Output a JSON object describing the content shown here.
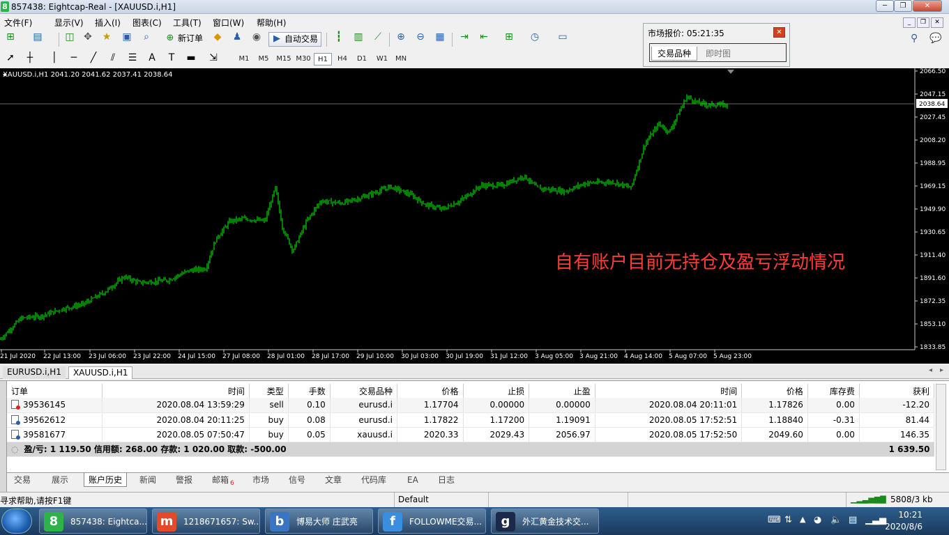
{
  "window": {
    "title": "857438: Eightcap-Real - [XAUUSD.i,H1]",
    "app_icon": "8"
  },
  "menu": [
    "文件(F)",
    "显示(V)",
    "插入(I)",
    "图表(C)",
    "工具(T)",
    "窗口(W)",
    "帮助(H)"
  ],
  "toolbar": {
    "new_order": "新订单",
    "auto_trading": "自动交易"
  },
  "timeframes": [
    "M1",
    "M5",
    "M15",
    "M30",
    "H1",
    "H4",
    "D1",
    "W1",
    "MN"
  ],
  "active_timeframe": "H1",
  "market_watch": {
    "title": "市场报价: 05:21:35",
    "tabs": [
      "交易品种",
      "即时图"
    ]
  },
  "chart": {
    "symbol_line": "XAUUSD.i,H1  2041.20 2041.62 2037.41 2038.64",
    "price_labels": [
      "2066.50",
      "2047.15",
      "2038.64",
      "2027.45",
      "2008.20",
      "1988.95",
      "1969.15",
      "1949.90",
      "1930.65",
      "1911.40",
      "1891.60",
      "1872.35",
      "1853.10",
      "1833.85"
    ],
    "current_price": "2038.64",
    "time_labels": [
      "21 Jul 2020",
      "22 Jul 13:00",
      "23 Jul 06:00",
      "23 Jul 22:00",
      "24 Jul 15:00",
      "27 Jul 08:00",
      "28 Jul 01:00",
      "28 Jul 17:00",
      "29 Jul 10:00",
      "30 Jul 03:00",
      "30 Jul 19:00",
      "31 Jul 12:00",
      "3 Aug 05:00",
      "3 Aug 21:00",
      "4 Aug 14:00",
      "5 Aug 07:00",
      "5 Aug 23:00"
    ],
    "annotation": "自有账户目前无持仓及盈亏浮动情况",
    "candle_color": "#00ff00"
  },
  "chart_tabs": [
    "EURUSD.i,H1",
    "XAUUSD.i,H1"
  ],
  "terminal": {
    "columns": [
      "订单",
      "时间",
      "类型",
      "手数",
      "交易品种",
      "价格",
      "止损",
      "止盈",
      "时间",
      "价格",
      "库存费",
      "获利"
    ],
    "rows": [
      [
        "39536145",
        "2020.08.04 13:59:29",
        "sell",
        "0.10",
        "eurusd.i",
        "1.17704",
        "0.00000",
        "0.00000",
        "2020.08.04 20:11:01",
        "1.17826",
        "0.00",
        "-12.20"
      ],
      [
        "39562612",
        "2020.08.04 20:11:25",
        "buy",
        "0.08",
        "eurusd.i",
        "1.17822",
        "1.17200",
        "1.19091",
        "2020.08.05 17:52:51",
        "1.18840",
        "-0.31",
        "81.44"
      ],
      [
        "39581677",
        "2020.08.05 07:50:47",
        "buy",
        "0.05",
        "xauusd.i",
        "2020.33",
        "2029.43",
        "2056.97",
        "2020.08.05 17:52:50",
        "2049.60",
        "0.00",
        "146.35"
      ]
    ],
    "summary": "盈/亏: 1 119.50  信用额: 268.00  存款: 1 020.00  取款: -500.00",
    "summary_total": "1 639.50",
    "tabs": [
      "交易",
      "展示",
      "账户历史",
      "新闻",
      "警报",
      "邮箱",
      "市场",
      "信号",
      "文章",
      "代码库",
      "EA",
      "日志"
    ],
    "mail_count": "6",
    "active_tab": "账户历史"
  },
  "status": {
    "help": "寻求帮助,请按F1键",
    "profile": "Default",
    "traffic": "5808/3 kb"
  },
  "taskbar": {
    "items": [
      {
        "label": "857438: Eightca...",
        "icon": "8"
      },
      {
        "label": "1218671657: Sw...",
        "icon": "m"
      },
      {
        "label": "博易大师 庄武亮",
        "icon": "b"
      },
      {
        "label": "FOLLOWME交易...",
        "icon": "f"
      },
      {
        "label": "外汇黄金技术交...",
        "icon": "g"
      }
    ],
    "time": "10:21",
    "date": "2020/8/6"
  }
}
